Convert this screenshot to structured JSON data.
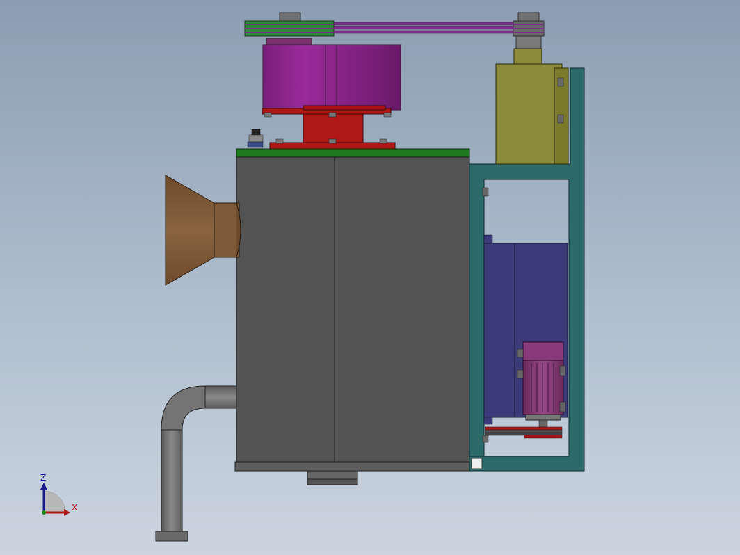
{
  "viewport": {
    "background_top": "#8c9db3",
    "background_bottom": "#cbd5e0"
  },
  "model": {
    "parts": [
      {
        "name": "drive-belt-pulley-assembly",
        "color": "#2d8a3a"
      },
      {
        "name": "belt",
        "color": "#7a2f8a"
      },
      {
        "name": "gearbox-motor",
        "color": "#8a1f8a"
      },
      {
        "name": "motor-mount-base",
        "color": "#b01818"
      },
      {
        "name": "top-plate",
        "color": "#1f7a1f"
      },
      {
        "name": "main-housing",
        "color": "#545454"
      },
      {
        "name": "inlet-hopper",
        "color": "#7a5535"
      },
      {
        "name": "outlet-pipe",
        "color": "#6e6e6e"
      },
      {
        "name": "side-frame",
        "color": "#2d6b6b"
      },
      {
        "name": "bearing-housing",
        "color": "#8a8a3a"
      },
      {
        "name": "blower-casing",
        "color": "#3b3b7a"
      },
      {
        "name": "small-motor",
        "color": "#8a3a7a"
      }
    ]
  },
  "triad": {
    "z_label": "Z",
    "x_label": "X",
    "z_color": "#1a1aa0",
    "x_color": "#b01818"
  }
}
